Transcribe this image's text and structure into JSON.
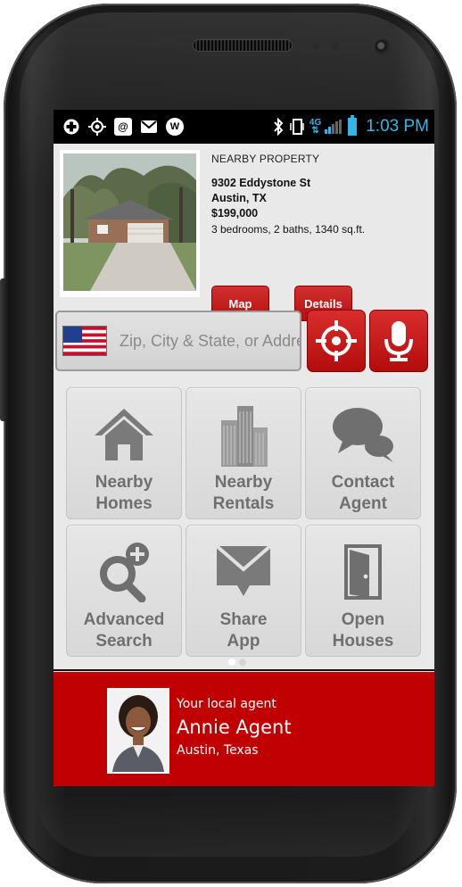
{
  "status_bar": {
    "left_icons": [
      "medical-plus-icon",
      "gps-target-icon",
      "at-sign-icon",
      "gmail-icon",
      "w-app-icon"
    ],
    "network_label": "4G",
    "time": "1:03 PM",
    "colors": {
      "accent": "#33b5e5",
      "background": "#000000"
    }
  },
  "property": {
    "heading": "NEARBY PROPERTY",
    "address": "9302 Eddystone St",
    "city": "Austin, TX",
    "price": "$199,000",
    "details": "3 bedrooms, 2 baths, 1340 sq.ft.",
    "map_label": "Map",
    "details_label": "Details"
  },
  "search": {
    "placeholder": "Zip, City & State, or Address",
    "flag_icon": "us-flag-icon",
    "locate_icon": "crosshair-icon",
    "voice_icon": "microphone-icon"
  },
  "tiles": [
    {
      "line1": "Nearby",
      "line2": "Homes",
      "icon": "house-icon"
    },
    {
      "line1": "Nearby",
      "line2": "Rentals",
      "icon": "buildings-icon"
    },
    {
      "line1": "Contact",
      "line2": "Agent",
      "icon": "chat-bubbles-icon"
    },
    {
      "line1": "Advanced",
      "line2": "Search",
      "icon": "magnifier-plus-icon"
    },
    {
      "line1": "Share",
      "line2": "App",
      "icon": "envelope-icon"
    },
    {
      "line1": "Open",
      "line2": "Houses",
      "icon": "open-door-icon"
    }
  ],
  "pager": {
    "pages": 2,
    "current": 1
  },
  "agent": {
    "caption": "Your local agent",
    "name": "Annie Agent",
    "location": "Austin, Texas"
  },
  "theme": {
    "brand_red": "#c00000",
    "button_red": "#c41f1f",
    "tile_text": "#6f6f6f",
    "screen_bg": "#e9e9e9"
  }
}
